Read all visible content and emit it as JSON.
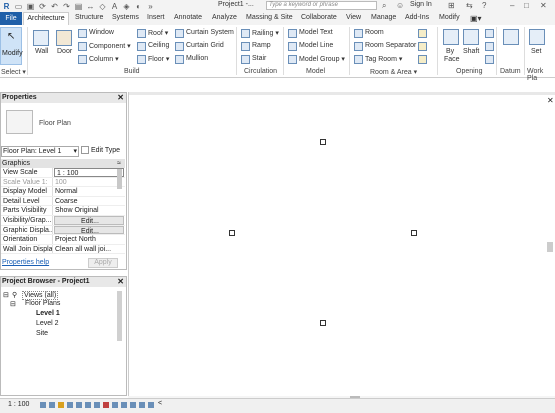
{
  "titlebar": {
    "qat_icons": [
      "revit-logo-icon",
      "open-icon",
      "save-icon",
      "sync-icon",
      "undo-icon",
      "redo-icon",
      "print-icon",
      "measure-icon",
      "tag-icon",
      "text-icon",
      "3d-icon",
      "section-icon",
      "more-icon"
    ],
    "doc_title": "Project1 -...",
    "search_placeholder": "Type a keyword or phrase",
    "signin": "Sign In"
  },
  "tabs": {
    "file": "File",
    "active": "Architecture",
    "others": [
      "Structure",
      "Systems",
      "Insert",
      "Annotate",
      "Analyze",
      "Massing & Site",
      "Collaborate",
      "View",
      "Manage",
      "Add-Ins",
      "Modify"
    ]
  },
  "ribbon": {
    "modify": "Modify",
    "select": "Select ▾",
    "build": {
      "wall": "Wall",
      "door": "Door",
      "window": "Window",
      "component": "Component ▾",
      "column": "Column ▾",
      "roof": "Roof ▾",
      "ceiling": "Ceiling",
      "floor": "Floor ▾",
      "curtain_system": "Curtain System",
      "curtain_grid": "Curtain Grid",
      "mullion": "Mullion",
      "label": "Build"
    },
    "circulation": {
      "railing": "Railing ▾",
      "ramp": "Ramp",
      "stair": "Stair",
      "label": "Circulation"
    },
    "model": {
      "model_text": "Model Text",
      "model_line": "Model Line",
      "model_group": "Model Group ▾",
      "label": "Model"
    },
    "room_area": {
      "room": "Room",
      "room_separator": "Room Separator",
      "tag_room": "Tag Room ▾",
      "label": "Room & Area ▾"
    },
    "opening": {
      "by_face": "By\nFace",
      "shaft": "Shaft",
      "label": "Opening"
    },
    "datum": {
      "label": "Datum"
    },
    "workplane": {
      "set": "Set",
      "label": "Work Pla"
    }
  },
  "properties": {
    "title": "Properties",
    "type_name": "Floor Plan",
    "selector": "Floor Plan: Level 1",
    "edit_type": "Edit Type",
    "group": "Graphics",
    "rows": [
      {
        "name": "View Scale",
        "value": "1 : 100"
      },
      {
        "name": "Scale Value    1:",
        "value": "100"
      },
      {
        "name": "Display Model",
        "value": "Normal"
      },
      {
        "name": "Detail Level",
        "value": "Coarse"
      },
      {
        "name": "Parts Visibility",
        "value": "Show Original"
      },
      {
        "name": "Visibility/Grap...",
        "value": "Edit..."
      },
      {
        "name": "Graphic Displa...",
        "value": "Edit..."
      },
      {
        "name": "Orientation",
        "value": "Project North"
      },
      {
        "name": "Wall Join Display",
        "value": "Clean all wall joi..."
      }
    ],
    "help": "Properties help",
    "apply": "Apply"
  },
  "browser": {
    "title": "Project Browser - Project1",
    "views": "Views (all)",
    "floor_plans": "Floor Plans",
    "level1": "Level 1",
    "level2": "Level 2",
    "site": "Site"
  },
  "status": {
    "scale": "1 : 100"
  }
}
